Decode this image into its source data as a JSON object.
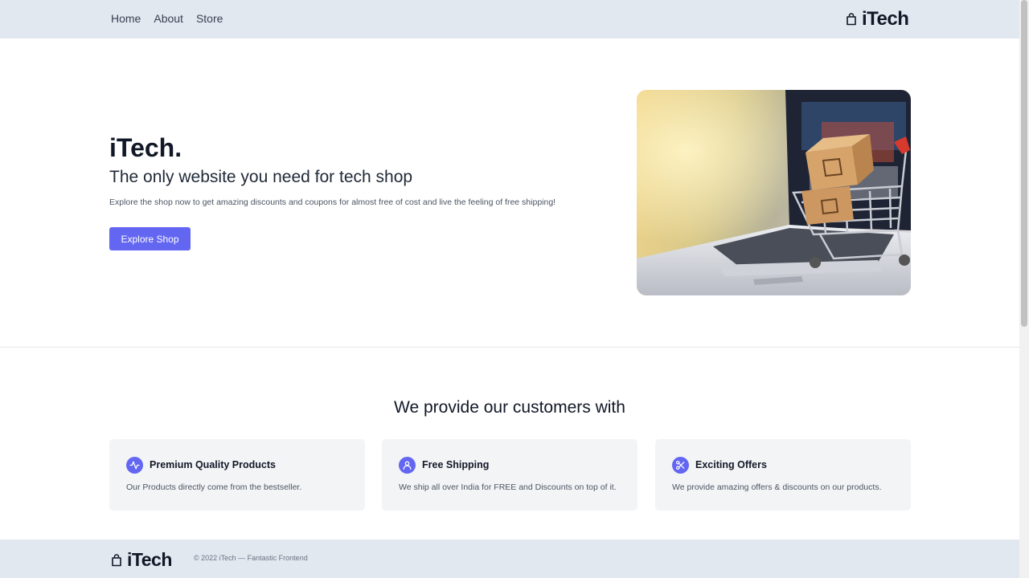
{
  "nav": {
    "items": [
      "Home",
      "About",
      "Store"
    ],
    "brand": "iTech",
    "brand_icon": "shopping-bag-icon"
  },
  "hero": {
    "title": "iTech.",
    "subtitle": "The only website you need for tech shop",
    "description": "Explore the shop now to get amazing discounts and coupons for almost free of cost and live the feeling of free shipping!",
    "button_label": "Explore Shop",
    "image": "laptop-with-shopping-cart-image"
  },
  "features": {
    "title": "We provide our customers with",
    "cards": [
      {
        "icon": "activity-icon",
        "title": "Premium Quality Products",
        "text": "Our Products directly come from the bestseller."
      },
      {
        "icon": "user-icon",
        "title": "Free Shipping",
        "text": "We ship all over India for FREE and Discounts on top of it."
      },
      {
        "icon": "scissors-icon",
        "title": "Exciting Offers",
        "text": "We provide amazing offers & discounts on our products."
      }
    ]
  },
  "footer": {
    "brand": "iTech",
    "copyright": "© 2022 iTech — Fantastic Frontend"
  },
  "colors": {
    "accent": "#6366f1",
    "header_bg": "#e2e8f0",
    "card_bg": "#f3f4f6"
  }
}
